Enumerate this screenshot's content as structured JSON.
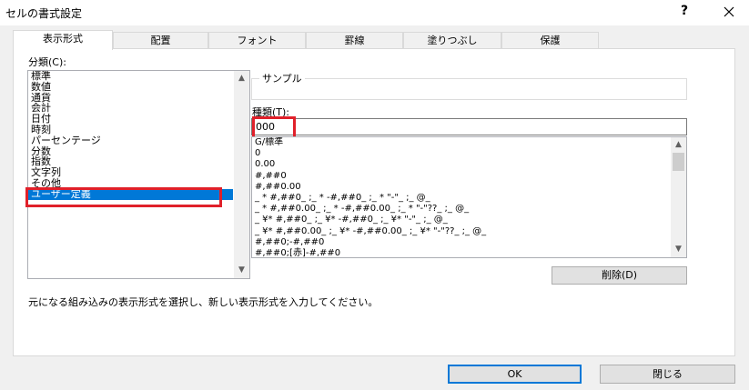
{
  "window": {
    "title": "セルの書式設定",
    "help": "?",
    "close": "✕"
  },
  "tabs": [
    "表示形式",
    "配置",
    "フォント",
    "罫線",
    "塗りつぶし",
    "保護"
  ],
  "category": {
    "label": "分類(C):",
    "items": [
      "標準",
      "数値",
      "通貨",
      "会計",
      "日付",
      "時刻",
      "パーセンテージ",
      "分数",
      "指数",
      "文字列",
      "その他",
      "ユーザー定義"
    ],
    "selected": "ユーザー定義"
  },
  "sample": {
    "label": "サンプル",
    "value": ""
  },
  "type_field": {
    "label": "種類(T):",
    "value": "000"
  },
  "formats": [
    "G/標準",
    "0",
    "0.00",
    "#,##0",
    "#,##0.00",
    "_ * #,##0_ ;_ * -#,##0_ ;_ * \"-\"_ ;_ @_",
    "_ * #,##0.00_ ;_ * -#,##0.00_ ;_ * \"-\"??_ ;_ @_",
    "_ ¥* #,##0_ ;_ ¥* -#,##0_ ;_ ¥* \"-\"_ ;_ @_",
    "_ ¥* #,##0.00_ ;_ ¥* -#,##0.00_ ;_ ¥* \"-\"??_ ;_ @_",
    "#,##0;-#,##0",
    "#,##0;[赤]-#,##0"
  ],
  "delete_button": "削除(D)",
  "description": "元になる組み込みの表示形式を選択し、新しい表示形式を入力してください。",
  "ok_button": "OK",
  "close_button": "閉じる",
  "colors": {
    "selection": "#0078d7",
    "highlight": "#e0202a"
  }
}
